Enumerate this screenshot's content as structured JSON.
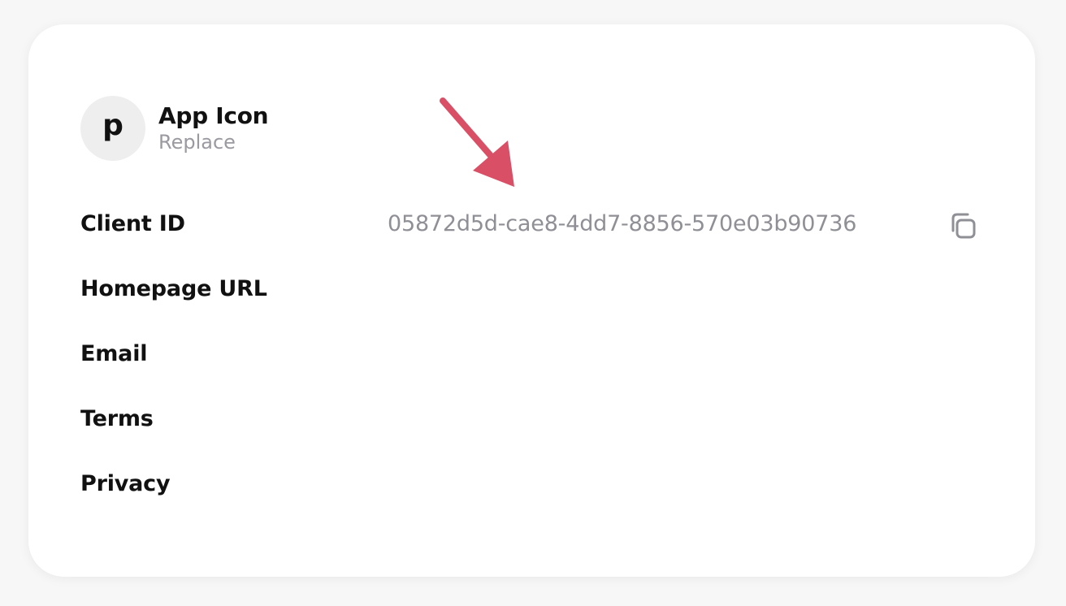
{
  "app": {
    "avatar_letter": "p",
    "title": "App Icon",
    "replace_label": "Replace"
  },
  "fields": {
    "client_id_label": "Client ID",
    "client_id_value": "05872d5d-cae8-4dd7-8856-570e03b90736",
    "homepage_label": "Homepage URL",
    "email_label": "Email",
    "terms_label": "Terms",
    "privacy_label": "Privacy"
  },
  "icons": {
    "copy": "copy-icon",
    "annotation_arrow": "arrow-icon"
  },
  "colors": {
    "arrow": "#d94f66",
    "muted_text": "#8f8f96",
    "avatar_bg": "#eeeeef"
  }
}
